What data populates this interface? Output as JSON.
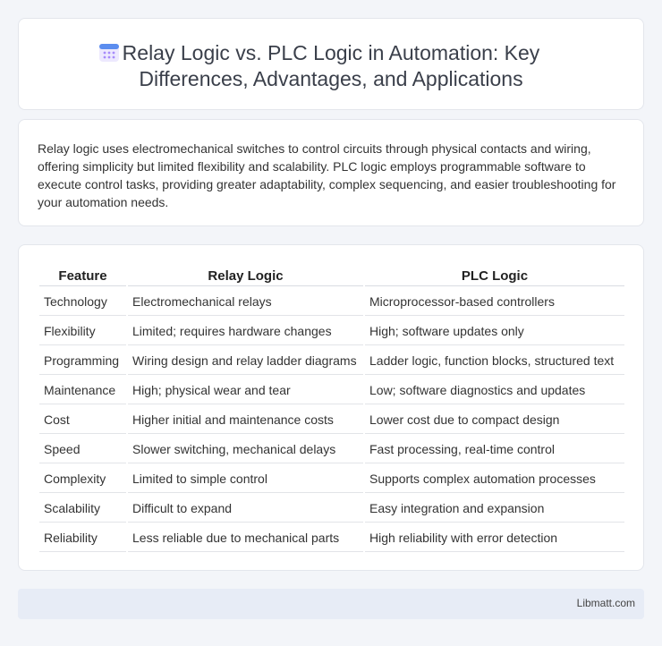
{
  "header": {
    "icon": "calendar-icon",
    "title_line1": "Relay Logic vs. PLC Logic in Automation: Key",
    "title_line2": "Differences, Advantages, and Applications"
  },
  "summary": "Relay logic uses electromechanical switches to control circuits through physical contacts and wiring, offering simplicity but limited flexibility and scalability. PLC logic employs programmable software to execute control tasks, providing greater adaptability, complex sequencing, and easier troubleshooting for your automation needs.",
  "table": {
    "headers": [
      "Feature",
      "Relay Logic",
      "PLC Logic"
    ],
    "rows": [
      [
        "Technology",
        "Electromechanical relays",
        "Microprocessor-based controllers"
      ],
      [
        "Flexibility",
        "Limited; requires hardware changes",
        "High; software updates only"
      ],
      [
        "Programming",
        "Wiring design and relay ladder diagrams",
        "Ladder logic, function blocks, structured text"
      ],
      [
        "Maintenance",
        "High; physical wear and tear",
        "Low; software diagnostics and updates"
      ],
      [
        "Cost",
        "Higher initial and maintenance costs",
        "Lower cost due to compact design"
      ],
      [
        "Speed",
        "Slower switching, mechanical delays",
        "Fast processing, real-time control"
      ],
      [
        "Complexity",
        "Limited to simple control",
        "Supports complex automation processes"
      ],
      [
        "Scalability",
        "Difficult to expand",
        "Easy integration and expansion"
      ],
      [
        "Reliability",
        "Less reliable due to mechanical parts",
        "High reliability with error detection"
      ]
    ]
  },
  "footer": {
    "brand": "Libmatt.com"
  },
  "colors": {
    "icon_blue": "#5b8def",
    "icon_purple": "#a78bfa",
    "footer_bg": "#e7ecf6"
  }
}
